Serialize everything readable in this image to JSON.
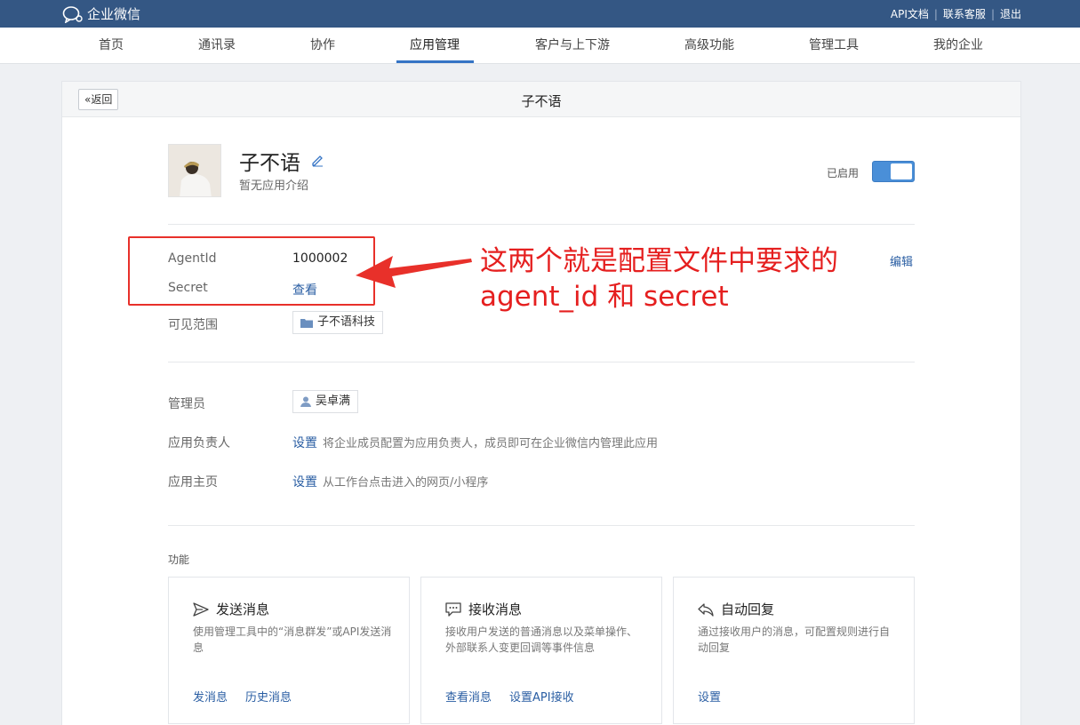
{
  "topbar": {
    "logo_text": "企业微信",
    "links": [
      "API文档",
      "联系客服",
      "退出"
    ]
  },
  "nav": {
    "items": [
      "首页",
      "通讯录",
      "协作",
      "应用管理",
      "客户与上下游",
      "高级功能",
      "管理工具",
      "我的企业"
    ],
    "active": "应用管理"
  },
  "card": {
    "back_label": "返回",
    "title": "子不语"
  },
  "app": {
    "name": "子不语",
    "intro": "暂无应用介绍",
    "status_label": "已启用"
  },
  "info": {
    "agentid_label": "AgentId",
    "agentid_value": "1000002",
    "secret_label": "Secret",
    "secret_action": "查看",
    "edit_label": "编辑",
    "scope_label": "可见范围",
    "scope_value": "子不语科技"
  },
  "annotation": {
    "line1": "这两个就是配置文件中要求的",
    "line2": "agent_id  和  secret"
  },
  "admin": {
    "admin_label": "管理员",
    "admin_value": "吴卓满",
    "owner_label": "应用负责人",
    "owner_action": "设置",
    "owner_hint": "将企业成员配置为应用负责人，成员即可在企业微信内管理此应用",
    "home_label": "应用主页",
    "home_action": "设置",
    "home_hint": "从工作台点击进入的网页/小程序"
  },
  "features": {
    "section_label": "功能",
    "items": [
      {
        "title": "发送消息",
        "desc": "使用管理工具中的“消息群发”或API发送消息",
        "links": [
          "发消息",
          "历史消息"
        ]
      },
      {
        "title": "接收消息",
        "desc": "接收用户发送的普通消息以及菜单操作、外部联系人变更回调等事件信息",
        "links": [
          "查看消息",
          "设置API接收"
        ]
      },
      {
        "title": "自动回复",
        "desc": "通过接收用户的消息，可配置规则进行自动回复",
        "links": [
          "设置"
        ]
      }
    ]
  },
  "colors": {
    "topbar": "#345784",
    "accent": "#3574c5",
    "link": "#2a5ea3",
    "annotation": "#e51f1f"
  }
}
